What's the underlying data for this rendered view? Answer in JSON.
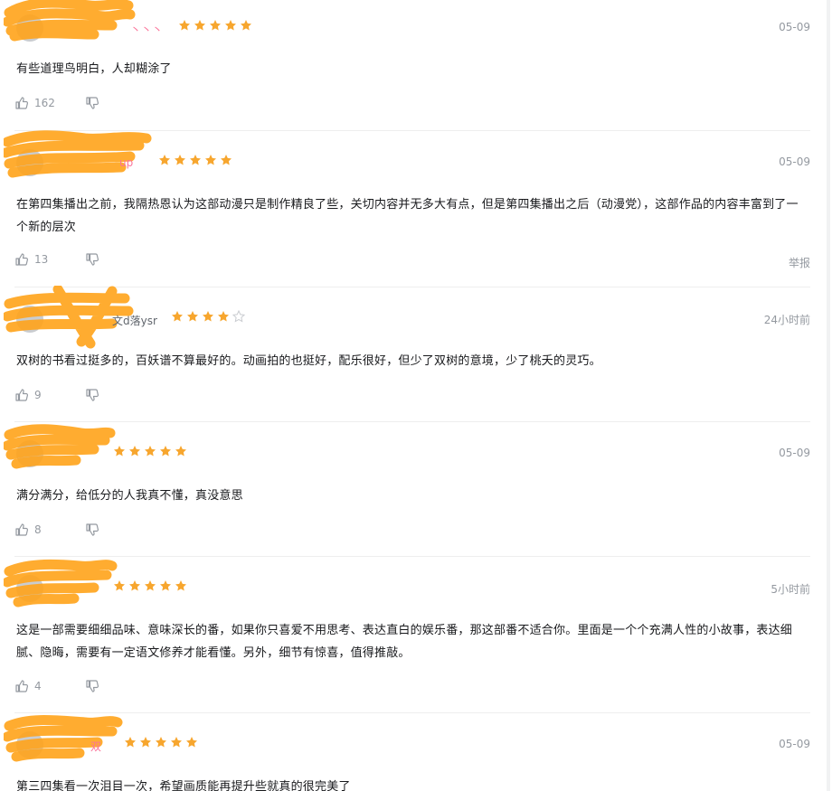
{
  "colors": {
    "star": "#f7a62e",
    "star_empty": "#c9ccd0",
    "username": "#fb7299",
    "meta": "#9499a0",
    "scribble": "#ffa31a"
  },
  "icons": {
    "like": "thumbs-up-icon",
    "dislike": "thumbs-down-icon",
    "star": "star-icon"
  },
  "comments": [
    {
      "username": "丶丶丶",
      "rating": 5,
      "date": "05-09",
      "content": "有些道理鸟明白，人却糊涂了",
      "likes": "162"
    },
    {
      "username": "up",
      "rating": 5,
      "date": "05-09",
      "content": "在第四集播出之前，我隔热恩认为这部动漫只是制作精良了些，关切内容并无多大有点，但是第四集播出之后（动漫党），这部作品的内容丰富到了一个新的层次",
      "likes": "13",
      "report": "举报"
    },
    {
      "username": "文d落ysr",
      "rating": 4,
      "date": "24小时前",
      "content": "双树的书看过挺多的，百妖谱不算最好的。动画拍的也挺好，配乐很好，但少了双树的意境，少了桃夭的灵巧。",
      "likes": "9"
    },
    {
      "username": "",
      "rating": 5,
      "date": "05-09",
      "content": "满分满分，给低分的人我真不懂，真没意思",
      "likes": "8"
    },
    {
      "username": "",
      "rating": 5,
      "date": "5小时前",
      "content": "这是一部需要细细品味、意味深长的番，如果你只喜爱不用思考、表达直白的娱乐番，那这部番不适合你。里面是一个个充满人性的小故事，表达细腻、隐晦，需要有一定语文修养才能看懂。另外，细节有惊喜，值得推敲。",
      "likes": "4"
    },
    {
      "username": "双",
      "rating": 5,
      "date": "05-09",
      "content": "第三四集看一次泪目一次，希望画质能再提升些就真的很完美了"
    }
  ]
}
